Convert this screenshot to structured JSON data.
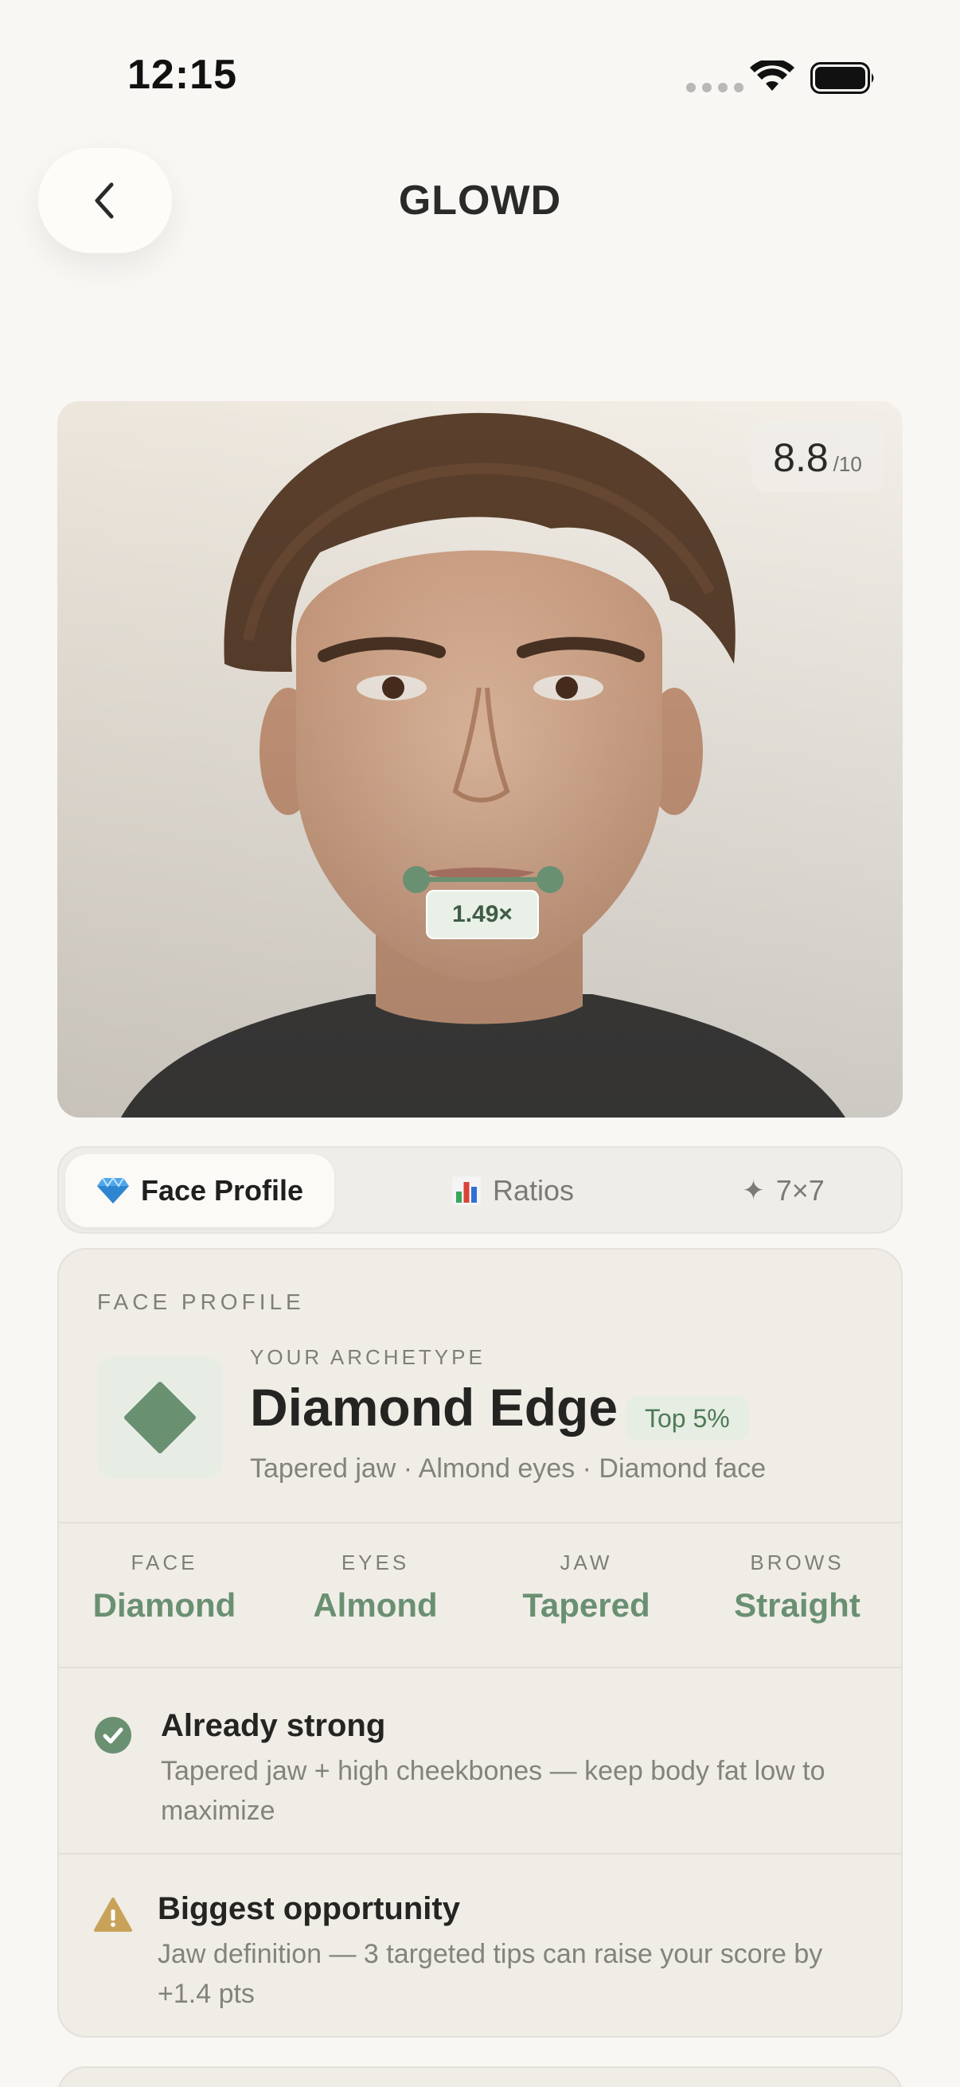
{
  "status_bar": {
    "time": "12:15"
  },
  "header": {
    "title": "GLOWD"
  },
  "photo": {
    "score": "8.8",
    "score_scale": "/10",
    "ratio_label": "1.49×"
  },
  "tabs": [
    {
      "label": "Face Profile",
      "icon": "gem-icon",
      "active": true
    },
    {
      "label": "Ratios",
      "icon": "bar-chart-icon",
      "active": false
    },
    {
      "label": "7×7",
      "icon": "sparkle-icon",
      "glyph": "✦",
      "active": false
    }
  ],
  "profile": {
    "section_label": "FACE PROFILE",
    "kicker": "YOUR ARCHETYPE",
    "archetype": "Diamond Edge",
    "rank": "Top 5%",
    "traits": "Tapered jaw · Almond eyes · Diamond face",
    "metrics": [
      {
        "label": "FACE",
        "value": "Diamond"
      },
      {
        "label": "EYES",
        "value": "Almond"
      },
      {
        "label": "JAW",
        "value": "Tapered"
      },
      {
        "label": "BROWS",
        "value": "Straight"
      }
    ],
    "strength": {
      "title": "Already strong",
      "body": "Tapered jaw + high cheekbones — keep body fat low to maximize"
    },
    "opportunity": {
      "title": "Biggest opportunity",
      "body": "Jaw definition — 3 targeted tips can raise your score by +1.4 pts"
    }
  },
  "colors": {
    "accent_green": "#6a9072",
    "warning_amber": "#c9a25a",
    "background": "#f8f7f4"
  }
}
